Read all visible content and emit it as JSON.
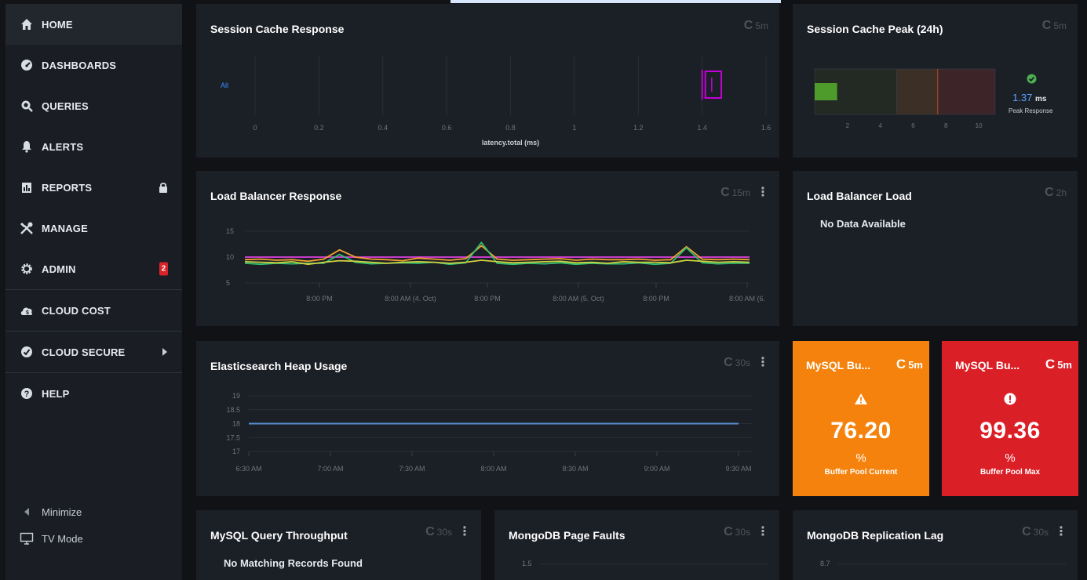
{
  "sidebar": {
    "items": [
      {
        "label": "HOME",
        "icon": "home-icon"
      },
      {
        "label": "DASHBOARDS",
        "icon": "dashboard-gauge-icon"
      },
      {
        "label": "QUERIES",
        "icon": "search-icon"
      },
      {
        "label": "ALERTS",
        "icon": "bell-icon"
      },
      {
        "label": "REPORTS",
        "icon": "report-icon"
      },
      {
        "label": "MANAGE",
        "icon": "tools-icon"
      },
      {
        "label": "ADMIN",
        "icon": "gear-icon",
        "badge": "2"
      },
      {
        "label": "CLOUD COST",
        "icon": "cloud-cost-icon"
      },
      {
        "label": "CLOUD SECURE",
        "icon": "shield-check-icon"
      },
      {
        "label": "HELP",
        "icon": "help-icon"
      }
    ],
    "minimize_label": "Minimize",
    "tv_mode_label": "TV Mode"
  },
  "panels": {
    "session_cache_response": {
      "title": "Session Cache Response",
      "refresh": "5m",
      "series_label": "All",
      "x_ticks": [
        "0",
        "0.2",
        "0.4",
        "0.6",
        "0.8",
        "1",
        "1.2",
        "1.4",
        "1.6"
      ],
      "xlabel": "latency.total (ms)"
    },
    "session_cache_peak": {
      "title": "Session Cache Peak (24h)",
      "refresh": "5m",
      "x_ticks": [
        "2",
        "4",
        "6",
        "8",
        "10"
      ],
      "value": "1.37",
      "unit": "ms",
      "caption": "Peak Response"
    },
    "load_balancer_response": {
      "title": "Load Balancer Response",
      "refresh": "15m",
      "y_ticks": [
        "15",
        "10",
        "5"
      ],
      "x_ticks": [
        "8:00 PM",
        "8:00 AM (4. Oct)",
        "8:00 PM",
        "8:00 AM (5. Oct)",
        "8:00 PM",
        "8:00 AM (6."
      ]
    },
    "load_balancer_load": {
      "title": "Load Balancer Load",
      "refresh": "2h",
      "message": "No Data Available"
    },
    "elasticsearch_heap": {
      "title": "Elasticsearch Heap Usage",
      "refresh": "30s",
      "y_ticks": [
        "19",
        "18.5",
        "18",
        "17.5",
        "17"
      ],
      "x_ticks": [
        "6:30 AM",
        "7:00 AM",
        "7:30 AM",
        "8:00 AM",
        "8:30 AM",
        "9:00 AM",
        "9:30 AM"
      ]
    },
    "mysql_bu_current": {
      "title": "MySQL Bu...",
      "refresh": "5m",
      "value": "76.20",
      "unit": "%",
      "caption": "Buffer Pool Current",
      "color": "#f5820c"
    },
    "mysql_bu_max": {
      "title": "MySQL Bu...",
      "refresh": "5m",
      "value": "99.36",
      "unit": "%",
      "caption": "Buffer Pool Max",
      "color": "#db1f26"
    },
    "mysql_query_throughput": {
      "title": "MySQL Query Throughput",
      "refresh": "30s",
      "message": "No Matching Records Found"
    },
    "mongodb_page_faults": {
      "title": "MongoDB Page Faults",
      "refresh": "30s",
      "y_ticks": [
        "1.5"
      ]
    },
    "mongodb_replication_lag": {
      "title": "MongoDB Replication Lag",
      "refresh": "30s",
      "y_ticks": [
        "8.7"
      ]
    }
  },
  "chart_data": [
    {
      "type": "line",
      "title": "Load Balancer Response",
      "ylim": [
        5,
        15
      ],
      "series": [
        {
          "color": "#e040e0",
          "values": [
            10,
            10,
            10,
            10,
            10,
            10,
            10,
            10,
            10,
            10,
            10,
            10,
            10,
            10,
            10,
            10,
            10,
            10,
            10,
            10,
            10,
            10,
            10,
            10,
            10,
            10,
            10,
            10,
            10,
            10,
            10,
            10,
            10
          ]
        },
        {
          "color": "#f0a030",
          "values": [
            9.5,
            9.6,
            9.4,
            9.5,
            9.2,
            9.6,
            11.4,
            10.0,
            9.6,
            9.5,
            9.3,
            9.8,
            9.6,
            9.4,
            9.7,
            12.2,
            9.6,
            9.4,
            9.5,
            9.6,
            9.7,
            9.4,
            9.6,
            9.5,
            9.5,
            9.6,
            9.4,
            9.5,
            12.0,
            9.6,
            9.5,
            9.6,
            9.5
          ]
        },
        {
          "color": "#30c070",
          "values": [
            8.8,
            8.6,
            8.8,
            8.7,
            8.8,
            8.8,
            10.5,
            9.0,
            8.7,
            8.8,
            8.9,
            8.8,
            9.0,
            8.6,
            8.9,
            12.8,
            8.8,
            8.6,
            8.8,
            8.7,
            8.9,
            8.6,
            8.8,
            8.7,
            8.7,
            8.9,
            8.6,
            8.8,
            11.8,
            8.9,
            8.7,
            8.8,
            8.8
          ]
        },
        {
          "color": "#d0d040",
          "values": [
            9.1,
            9.0,
            8.9,
            9.1,
            8.6,
            9.0,
            9.3,
            9.2,
            9.0,
            8.8,
            9.0,
            9.1,
            9.0,
            8.8,
            9.0,
            9.4,
            9.1,
            8.9,
            9.0,
            9.1,
            9.2,
            8.9,
            9.0,
            8.8,
            9.1,
            9.0,
            9.0,
            8.9,
            9.4,
            9.2,
            9.0,
            9.1,
            9.0
          ]
        }
      ]
    },
    {
      "type": "line",
      "title": "Elasticsearch Heap Usage",
      "x": [
        "6:30 AM",
        "7:00 AM",
        "7:30 AM",
        "8:00 AM",
        "8:30 AM",
        "9:00 AM",
        "9:30 AM"
      ],
      "ylim": [
        17,
        19
      ],
      "series": [
        {
          "color": "#5b8fd6",
          "values": [
            18,
            18,
            18,
            18,
            18,
            18,
            18
          ]
        }
      ]
    },
    {
      "type": "box",
      "title": "Session Cache Response",
      "xlim": [
        0,
        1.6
      ],
      "box": {
        "whisker_low": 1.4,
        "q1": 1.41,
        "median": 1.43,
        "q3": 1.46,
        "whisker_high": 1.46
      }
    },
    {
      "type": "bar",
      "title": "Session Cache Peak (24h)",
      "value": 1.37,
      "bands": [
        {
          "from": 0,
          "to": 5,
          "color": "#232a24"
        },
        {
          "from": 5,
          "to": 7.5,
          "color": "#3b2f26"
        },
        {
          "from": 7.5,
          "to": 11,
          "color": "#3d2428"
        }
      ]
    }
  ]
}
